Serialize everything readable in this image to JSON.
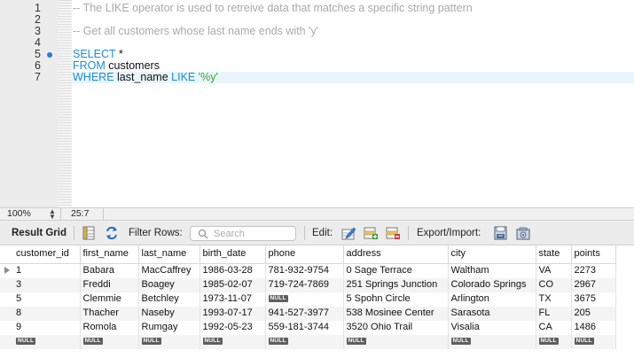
{
  "editor": {
    "lines": [
      {
        "num": "1",
        "tokens": [
          {
            "t": "-- The LIKE operator is used to retreive data that matches a specific string pattern",
            "c": "comment"
          }
        ]
      },
      {
        "num": "2",
        "tokens": []
      },
      {
        "num": "3",
        "tokens": [
          {
            "t": "-- Get all customers whose last name ends with 'y'",
            "c": "comment"
          }
        ]
      },
      {
        "num": "4",
        "tokens": []
      },
      {
        "num": "5",
        "tokens": [
          {
            "t": "SELECT",
            "c": "kw"
          },
          {
            "t": " *",
            "c": "plain"
          }
        ],
        "breakpoint": true
      },
      {
        "num": "6",
        "tokens": [
          {
            "t": "FROM",
            "c": "kw"
          },
          {
            "t": " customers",
            "c": "plain"
          }
        ]
      },
      {
        "num": "7",
        "tokens": [
          {
            "t": "WHERE",
            "c": "kw"
          },
          {
            "t": " last_name ",
            "c": "plain"
          },
          {
            "t": "LIKE",
            "c": "kw"
          },
          {
            "t": " ",
            "c": "plain"
          },
          {
            "t": "'%y'",
            "c": "str"
          }
        ],
        "active": true
      }
    ]
  },
  "status": {
    "zoom": "100%",
    "cursor": "25:7"
  },
  "toolbar": {
    "result_grid_label": "Result Grid",
    "filter_rows_label": "Filter Rows:",
    "search_placeholder": "Search",
    "edit_label": "Edit:",
    "export_import_label": "Export/Import:",
    "icons": [
      "grid-layout-icon",
      "refresh-icon",
      "search-icon",
      "edit-row-icon",
      "add-row-icon",
      "delete-row-icon",
      "export-icon",
      "import-icon"
    ]
  },
  "grid": {
    "columns": [
      "customer_id",
      "first_name",
      "last_name",
      "birth_date",
      "phone",
      "address",
      "city",
      "state",
      "points"
    ],
    "rows": [
      [
        "1",
        "Babara",
        "MacCaffrey",
        "1986-03-28",
        "781-932-9754",
        "0 Sage Terrace",
        "Waltham",
        "VA",
        "2273"
      ],
      [
        "3",
        "Freddi",
        "Boagey",
        "1985-02-07",
        "719-724-7869",
        "251 Springs Junction",
        "Colorado Springs",
        "CO",
        "2967"
      ],
      [
        "5",
        "Clemmie",
        "Betchley",
        "1973-11-07",
        "NULL",
        "5 Spohn Circle",
        "Arlington",
        "TX",
        "3675"
      ],
      [
        "8",
        "Thacher",
        "Naseby",
        "1993-07-17",
        "941-527-3977",
        "538 Mosinee Center",
        "Sarasota",
        "FL",
        "205"
      ],
      [
        "9",
        "Romola",
        "Rumgay",
        "1992-05-23",
        "559-181-3744",
        "3520 Ohio Trail",
        "Visalia",
        "CA",
        "1486"
      ],
      [
        "NULL",
        "NULL",
        "NULL",
        "NULL",
        "NULL",
        "NULL",
        "NULL",
        "NULL",
        "NULL"
      ]
    ],
    "null_text": "NULL"
  },
  "colors": {
    "keyword": "#1f8bd1",
    "string": "#3aa53a",
    "comment": "#a9a9a9",
    "active_line": "#e8f6fb",
    "breakpoint": "#2b7bd6"
  }
}
